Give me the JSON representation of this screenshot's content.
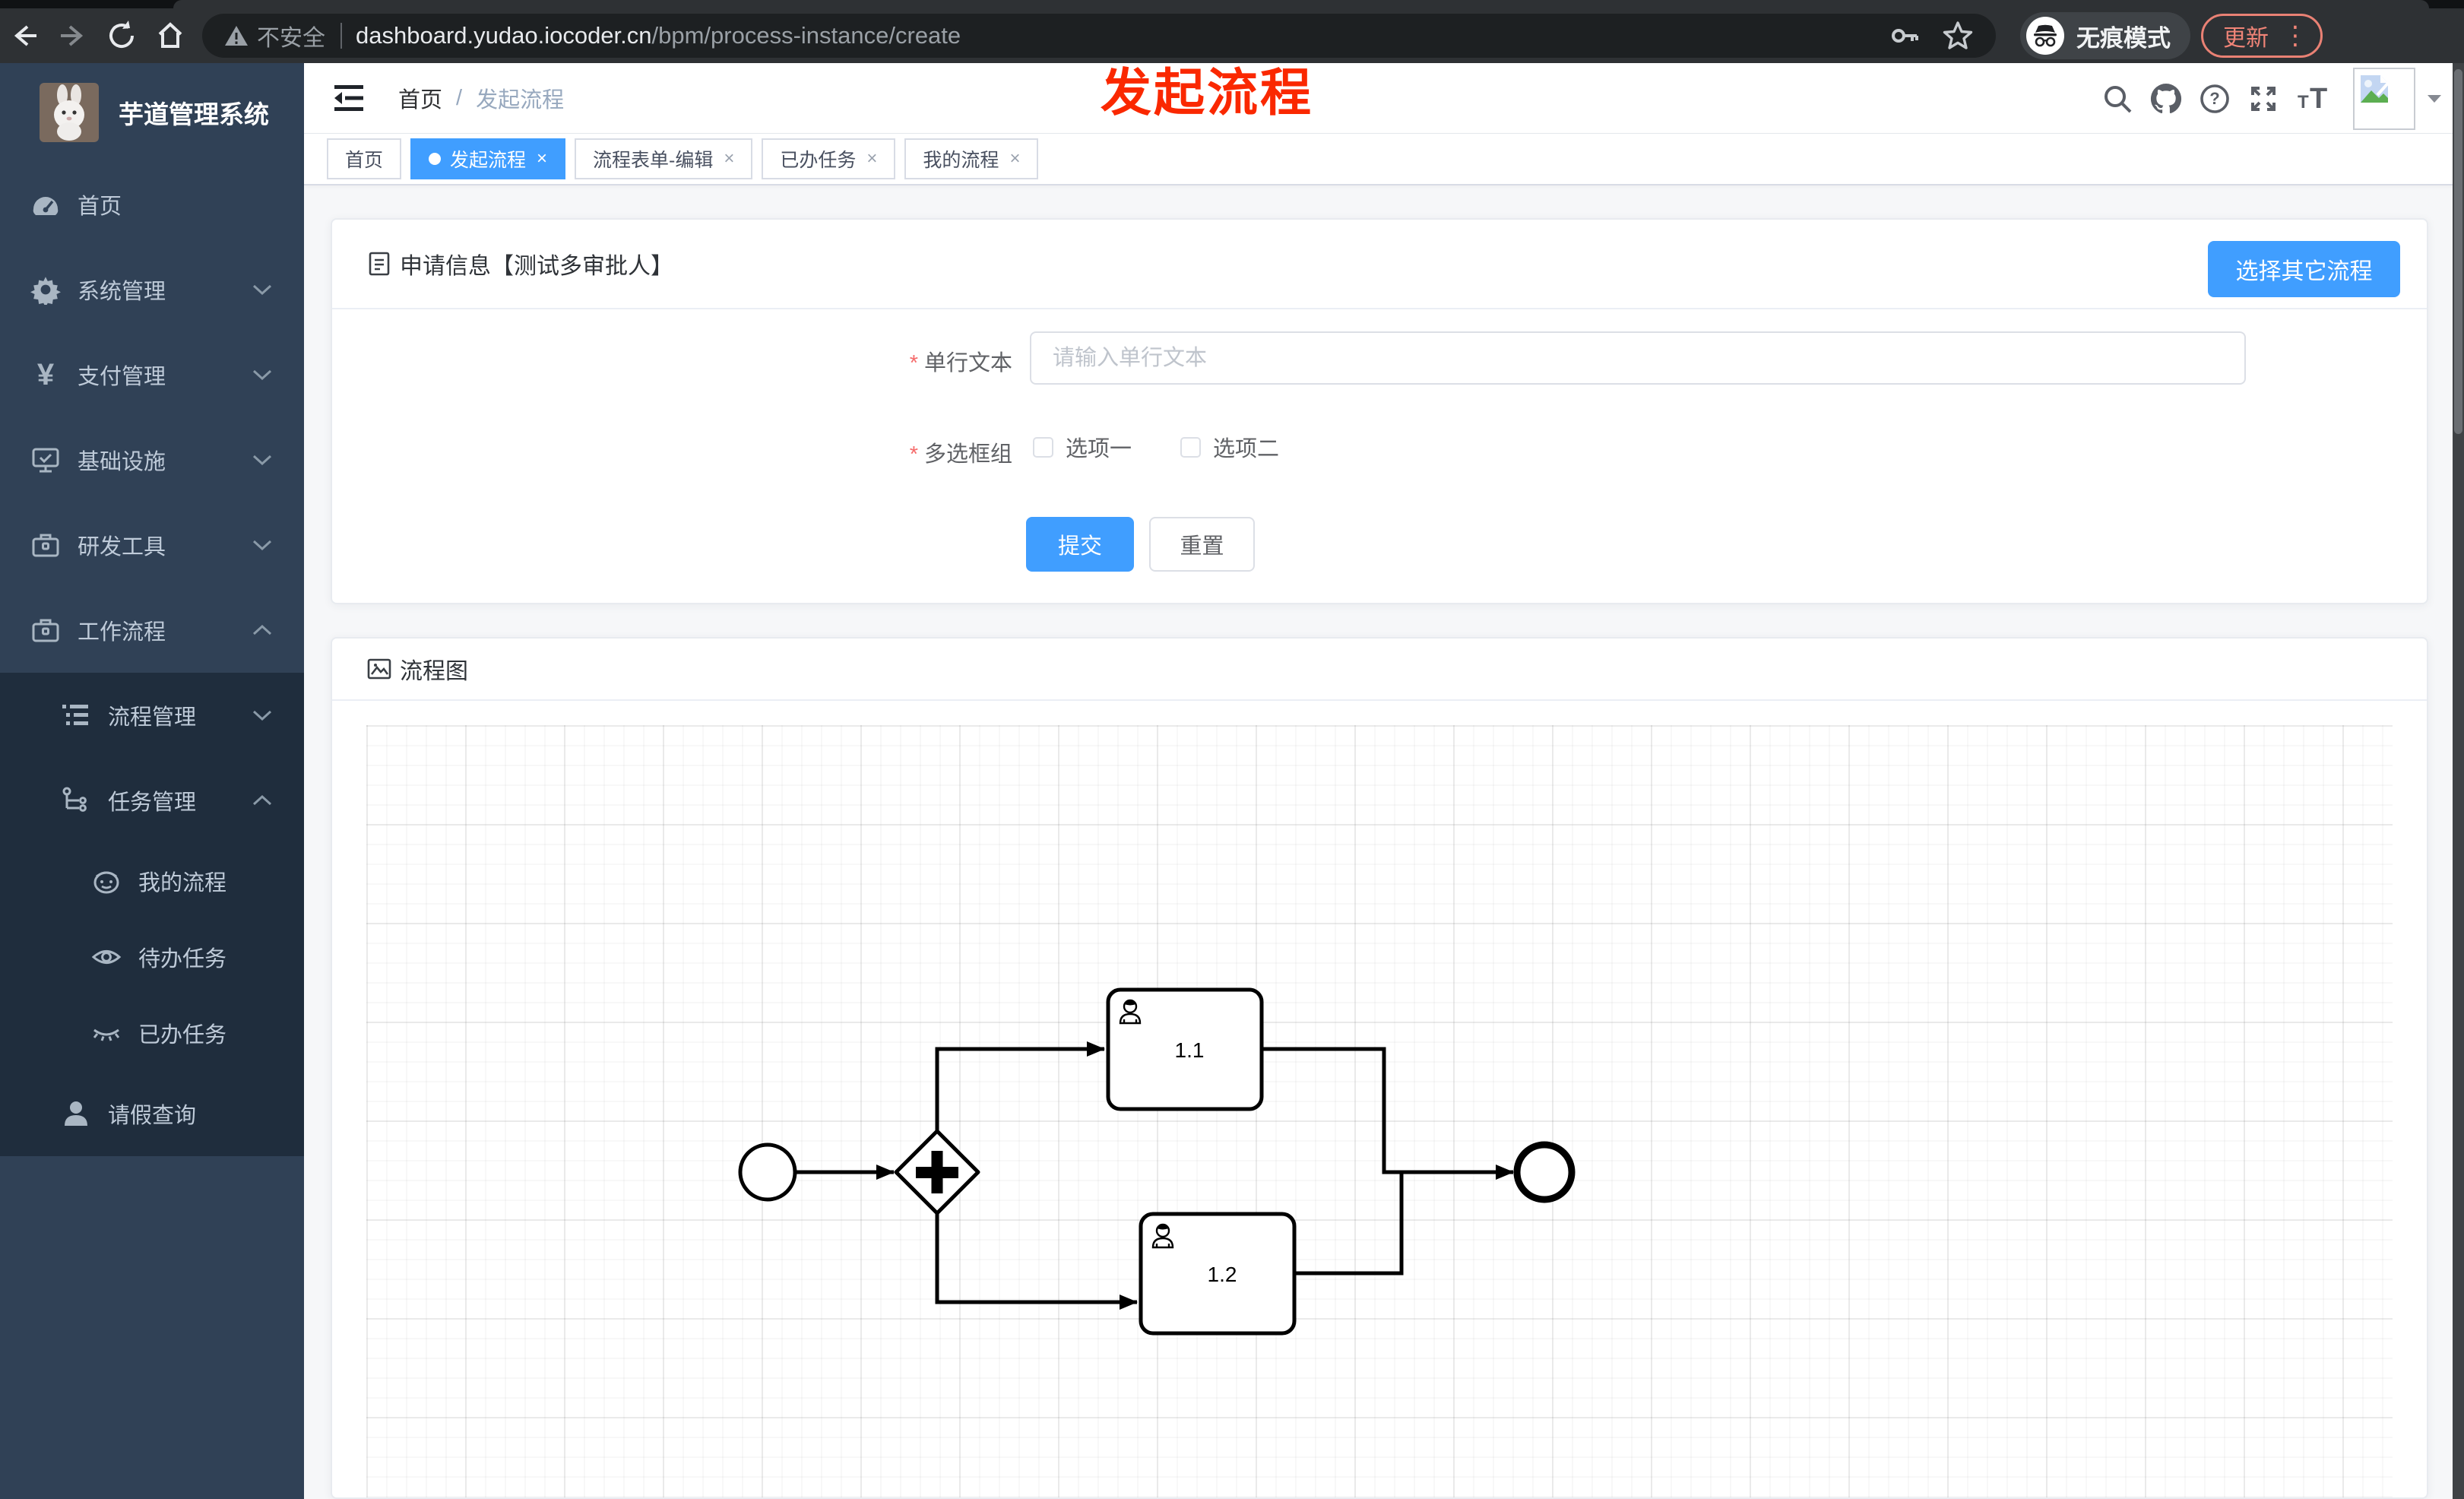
{
  "browser": {
    "security_label": "不安全",
    "url_host": "dashboard.yudao.iocoder.cn",
    "url_path": "/bpm/process-instance/create",
    "incognito_label": "无痕模式",
    "update_label": "更新"
  },
  "overlay_title": "发起流程",
  "sidebar": {
    "logo_title": "芋道管理系统",
    "items": [
      {
        "label": "首页",
        "icon": "dashboard-icon",
        "level": 1
      },
      {
        "label": "系统管理",
        "icon": "gear-icon",
        "level": 1,
        "chevron": "down"
      },
      {
        "label": "支付管理",
        "icon": "yen-icon",
        "level": 1,
        "chevron": "down"
      },
      {
        "label": "基础设施",
        "icon": "monitor-icon",
        "level": 1,
        "chevron": "down"
      },
      {
        "label": "研发工具",
        "icon": "toolbox-icon",
        "level": 1,
        "chevron": "down"
      },
      {
        "label": "工作流程",
        "icon": "toolbox-icon",
        "level": 1,
        "chevron": "up"
      },
      {
        "label": "流程管理",
        "icon": "list-icon",
        "level": 2,
        "chevron": "down"
      },
      {
        "label": "任务管理",
        "icon": "tree-icon",
        "level": 2,
        "chevron": "up"
      },
      {
        "label": "我的流程",
        "icon": "face-icon",
        "level": 3
      },
      {
        "label": "待办任务",
        "icon": "eye-icon",
        "level": 3
      },
      {
        "label": "已办任务",
        "icon": "eye-closed-icon",
        "level": 3
      },
      {
        "label": "请假查询",
        "icon": "user-icon",
        "level": 2
      }
    ]
  },
  "header": {
    "breadcrumb": [
      "首页",
      "发起流程"
    ]
  },
  "tabs": [
    {
      "label": "首页",
      "active": false,
      "closable": false
    },
    {
      "label": "发起流程",
      "active": true,
      "closable": true
    },
    {
      "label": "流程表单-编辑",
      "active": false,
      "closable": true
    },
    {
      "label": "已办任务",
      "active": false,
      "closable": true
    },
    {
      "label": "我的流程",
      "active": false,
      "closable": true
    }
  ],
  "form_card": {
    "title": "申请信息【测试多审批人】",
    "choose_button": "选择其它流程",
    "fields": {
      "text": {
        "label": "单行文本",
        "required": true,
        "placeholder": "请输入单行文本",
        "value": ""
      },
      "checkbox_group": {
        "label": "多选框组",
        "required": true,
        "options": [
          {
            "label": "选项一",
            "checked": false
          },
          {
            "label": "选项二",
            "checked": false
          }
        ]
      }
    },
    "submit_label": "提交",
    "reset_label": "重置"
  },
  "diagram_card": {
    "title": "流程图",
    "nodes": {
      "start": "start-event",
      "gateway": "parallel-gateway",
      "task1": "1.1",
      "task2": "1.2",
      "end": "end-event"
    }
  },
  "colors": {
    "accent": "#409eff",
    "overlay_red": "#fa2800",
    "sidebar_bg": "#304156",
    "submenu_bg": "#1f2d3d",
    "active_tab": "#409eff"
  }
}
